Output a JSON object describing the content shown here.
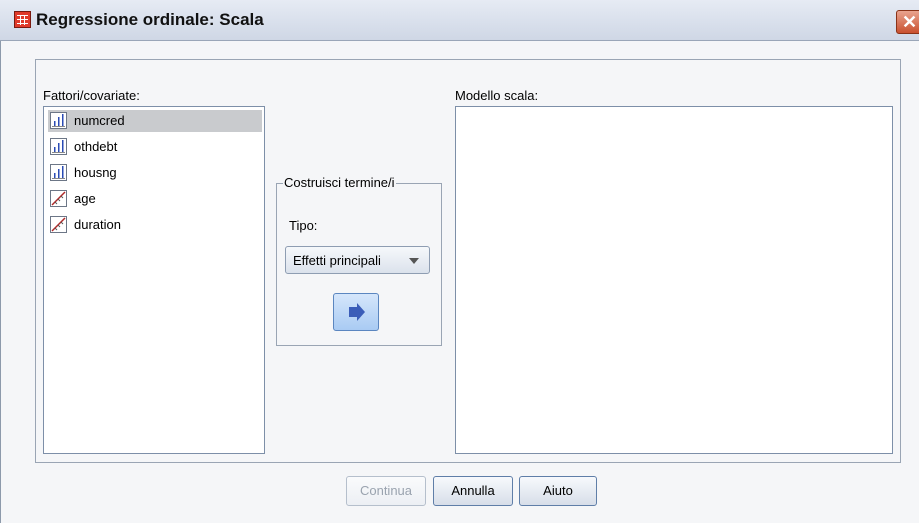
{
  "window": {
    "title": "Regressione ordinale: Scala",
    "close_glyph": "✕"
  },
  "factors": {
    "label": "Fattori/covariate:",
    "items": [
      {
        "name": "numcred",
        "icon": "ordinal-bars-icon",
        "selected": true
      },
      {
        "name": "othdebt",
        "icon": "ordinal-bars-icon",
        "selected": false
      },
      {
        "name": "housng",
        "icon": "ordinal-bars-icon",
        "selected": false
      },
      {
        "name": "age",
        "icon": "scale-ruler-icon",
        "selected": false
      },
      {
        "name": "duration",
        "icon": "scale-ruler-icon",
        "selected": false
      }
    ]
  },
  "build_terms": {
    "legend": "Costruisci termine/i",
    "type_label": "Tipo:",
    "type_value": "Effetti principali"
  },
  "model": {
    "label": "Modello scala:"
  },
  "buttons": {
    "continue": "Continua",
    "cancel": "Annulla",
    "help": "Aiuto"
  },
  "colors": {
    "selection": "#c9cbce",
    "arrow_button": "#a9cbf3",
    "close_button": "#c9502f"
  }
}
